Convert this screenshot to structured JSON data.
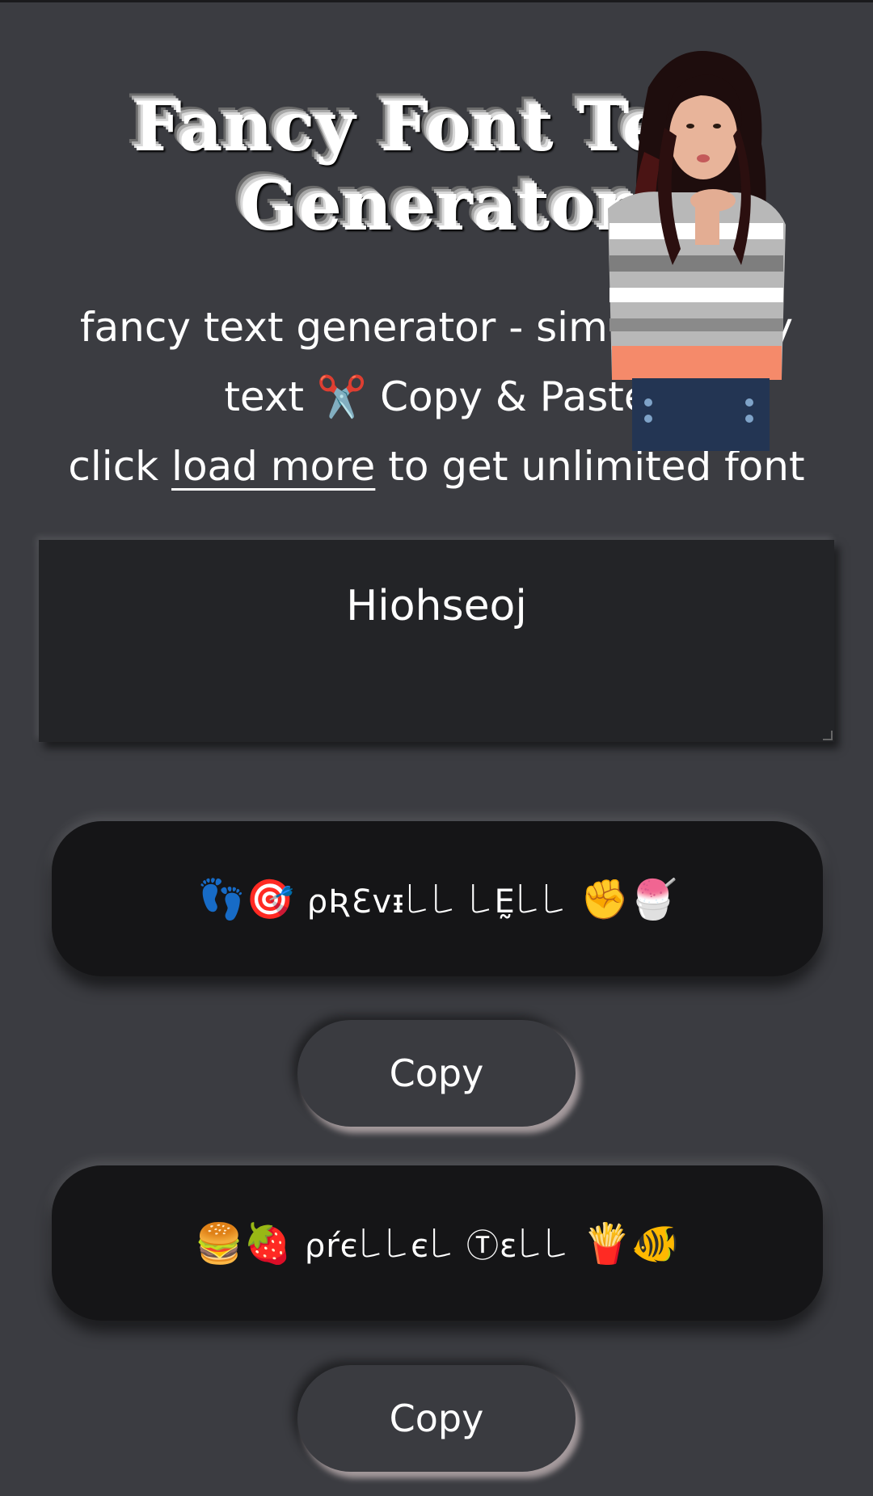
{
  "header": {
    "title_line1": "Fancy Font Text",
    "title_line2": "Generator"
  },
  "intro": {
    "line1": "fancy text generator - simple fancy",
    "line2_pre": "text",
    "line2_icon": "✂️",
    "line2_post": "Copy & Paste",
    "line3_pre": "click",
    "line3_link": "load more",
    "line3_post": "to get unlimited font"
  },
  "input": {
    "value": "Hiohseoj"
  },
  "results": [
    {
      "emoji_left": "👣🎯",
      "text": "ρƦƐvᵻ꒒꒒ ꒒Ḛ꒒꒒",
      "emoji_right": "✊🍧",
      "copy_label": "Copy"
    },
    {
      "emoji_left": "🍔🍓",
      "text": "ρŕє꒒꒒є꒒ Ⓣε꒒꒒",
      "emoji_right": "🍟🐠",
      "copy_label": "Copy"
    }
  ],
  "colors": {
    "background": "#3b3c41",
    "card": "#151517",
    "input": "#232427"
  },
  "icons": {
    "scissors": "scissors-icon",
    "photo": "person-photo"
  }
}
